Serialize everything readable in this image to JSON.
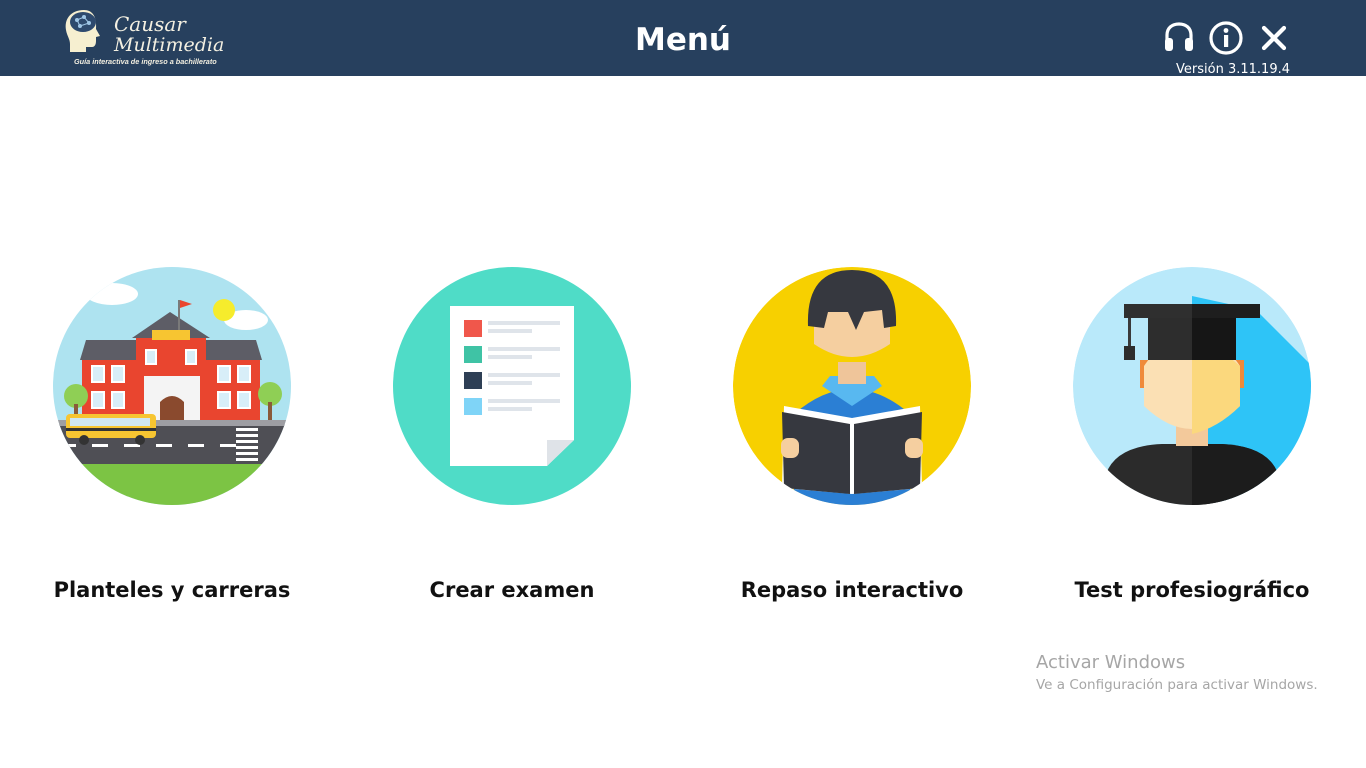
{
  "header": {
    "logo_line1": "Causar",
    "logo_line2": "Multimedia",
    "logo_tagline": "Guía interactiva de ingreso a bachillerato",
    "title": "Menú",
    "version": "Versión 3.11.19.4",
    "icons": [
      "headset-icon",
      "info-icon",
      "close-icon"
    ]
  },
  "menu": {
    "items": [
      {
        "label": "Planteles y carreras",
        "icon": "school-icon",
        "color": "#aee3f0"
      },
      {
        "label": "Crear examen",
        "icon": "exam-document-icon",
        "color": "#4fdcc7"
      },
      {
        "label": "Repaso interactivo",
        "icon": "student-reading-icon",
        "color": "#f7d000"
      },
      {
        "label": "Test profesiográfico",
        "icon": "graduate-icon",
        "color": "#aee3f0"
      }
    ]
  },
  "watermark": {
    "title": "Activar Windows",
    "subtitle": "Ve a Configuración para activar Windows."
  },
  "colors": {
    "header_bg": "#27405e",
    "background": "#ffffff",
    "label": "#111111"
  }
}
